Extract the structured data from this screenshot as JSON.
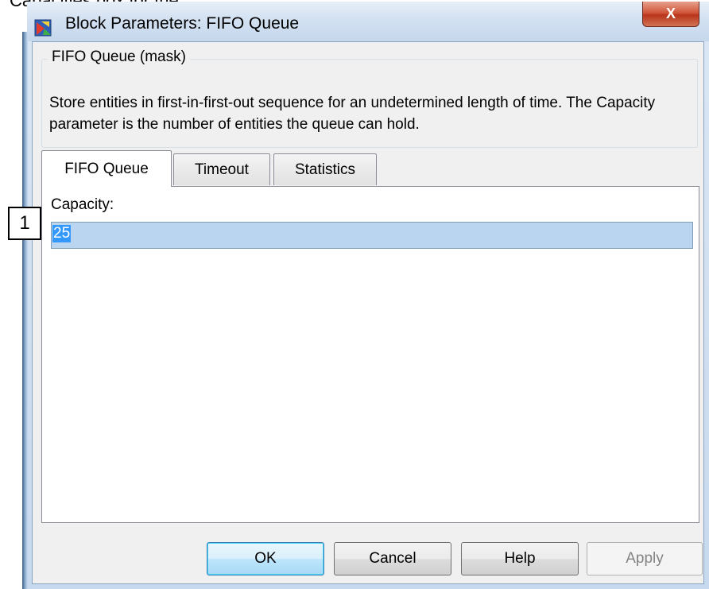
{
  "window": {
    "title": "Block Parameters: FIFO Queue",
    "close_glyph": "X",
    "icon": "simulink-block-icon"
  },
  "cropped_caption": "Capacities box for the",
  "mask": {
    "group_title": "FIFO Queue (mask)",
    "description": "Store entities in first-in-first-out sequence for an undetermined length of time. The Capacity parameter is the number of entities the queue can hold."
  },
  "tabs": [
    {
      "label": "FIFO Queue",
      "active": true
    },
    {
      "label": "Timeout",
      "active": false
    },
    {
      "label": "Statistics",
      "active": false
    }
  ],
  "fields": {
    "capacity_label": "Capacity:",
    "capacity_value": "25"
  },
  "callout": {
    "label": "1"
  },
  "buttons": {
    "ok": "OK",
    "cancel": "Cancel",
    "help": "Help",
    "apply": "Apply"
  },
  "colors": {
    "selection": "#3399ff",
    "close_button": "#c8462c",
    "default_button_border": "#3c7fb1"
  }
}
